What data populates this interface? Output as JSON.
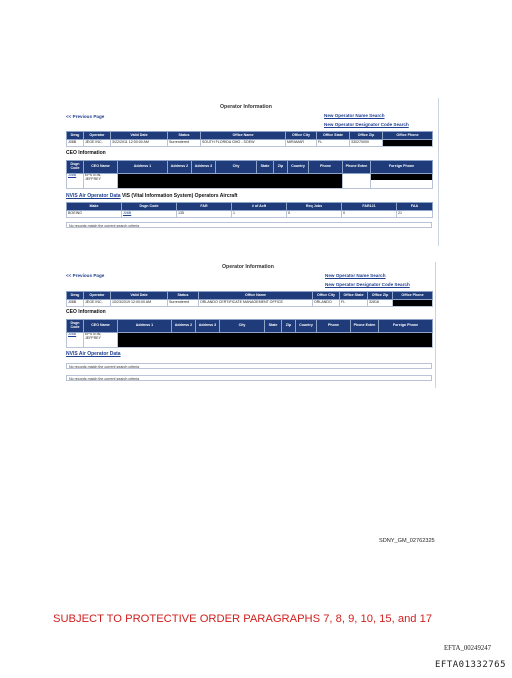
{
  "panel1": {
    "title": "Operator Information",
    "prev": "<< Previous Page",
    "link_name": "New Operator Name Search",
    "link_code": "New Operator Designator Code Search",
    "op_headers": [
      "Desg",
      "Operator",
      "Valid Date",
      "Status",
      "Office Name",
      "Office City",
      "Office State",
      "Office Zip",
      "Office Phone"
    ],
    "op_row": [
      "J08B",
      "JEGE INC.",
      "3/22/2011 12:00:00 AM",
      "Surrendered",
      "SOUTH FLORIDA CMO - SOEW",
      "MIRAMAR",
      "FL",
      "330270000",
      ""
    ],
    "ceo_title": "CEO Information",
    "ceo_headers": [
      "Dsgn Code",
      "CEO Name",
      "Address 1",
      "Address 2",
      "Address 3",
      "City",
      "State",
      "Zip",
      "Country",
      "Phone",
      "Phone Exten",
      "Foreign Phone"
    ],
    "ceo_row": [
      "J08B",
      "EPSTEIN, JEFFREY",
      "",
      "",
      "",
      "",
      "",
      "",
      "",
      "",
      "",
      ""
    ],
    "aircraft_link": "NVIS Air Operator Data",
    "aircraft_title": "VIS (Vital Information System) Operators Aircraft",
    "ac_headers": [
      "Make",
      "Dsgn Code",
      "FAR",
      "# of Acft",
      "Req Jobs",
      "FAR121",
      "FAA"
    ],
    "ac_row": [
      "BOEING",
      "J08B",
      "135",
      "1",
      "0",
      "0",
      "21"
    ],
    "no_records": "No records match the current search criteria"
  },
  "panel2": {
    "title": "Operator Information",
    "prev": "<< Previous Page",
    "link_name": "New Operator Name Search",
    "link_code": "New Operator Designator Code Search",
    "op_headers": [
      "Desg",
      "Operator",
      "Valid Date",
      "Status",
      "Office Name",
      "Office City",
      "Office State",
      "Office Zip",
      "Office Phone"
    ],
    "op_row": [
      "J08B",
      "JEGE INC.",
      "10/23/2019 12:00:00 AM",
      "Surrendered",
      "ORLANDO CERTIFICATE MANAGEMENT OFFICE",
      "ORLANDO",
      "FL",
      "32816",
      ""
    ],
    "ceo_title": "CEO Information",
    "ceo_headers": [
      "Dsgn Code",
      "CEO Name",
      "Address 1",
      "Address 2",
      "Address 3",
      "City",
      "State",
      "Zip",
      "Country",
      "Phone",
      "Phone Exten",
      "Foreign Phone"
    ],
    "ceo_row": [
      "J08B",
      "EPSTEIN, JEFFREY",
      "",
      "",
      "",
      "",
      "",
      "",
      "",
      "",
      "",
      ""
    ],
    "aircraft_link": "NVIS Air Operator Data",
    "no_records_1": "No records match the current search criteria",
    "no_records_2": "No records match the current search criteria"
  },
  "footer": {
    "bates": "SDNY_GM_02762325",
    "protective": "SUBJECT TO PROTECTIVE ORDER PARAGRAPHS 7, 8, 9, 10, 15, and 17",
    "efta_1": "EFTA_00249247",
    "efta_2": "EFTA01332765"
  },
  "colors": {
    "header_blue": "#1f3b7a",
    "link_blue": "#1f3f8f",
    "protective_red": "#d0201f",
    "redaction": "#000000"
  }
}
